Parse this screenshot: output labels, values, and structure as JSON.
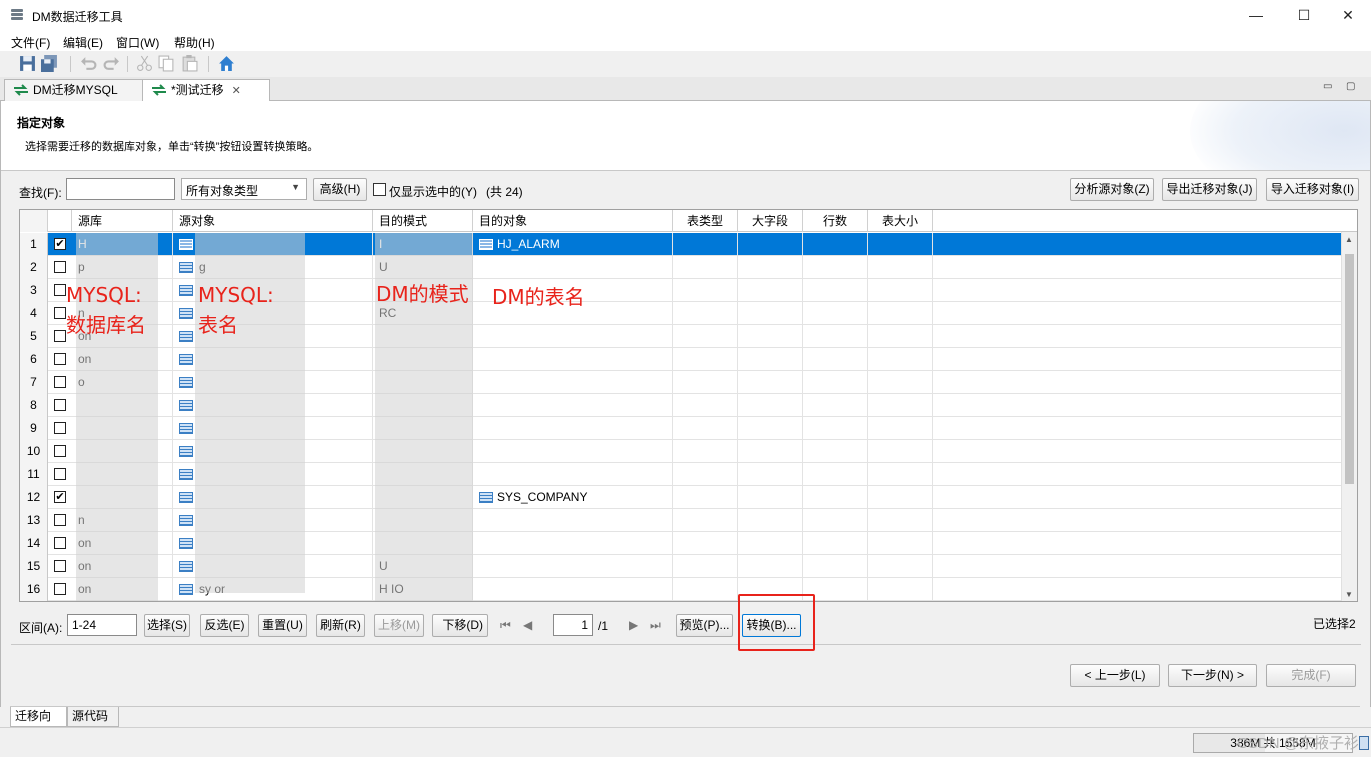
{
  "window": {
    "title": "DM数据迁移工具",
    "minimize": "—",
    "maximize": "☐",
    "close": "✕"
  },
  "menu": [
    "文件(F)",
    "编辑(E)",
    "窗口(W)",
    "帮助(H)"
  ],
  "tabs": [
    {
      "label": "DM迁移MYSQL",
      "active": false
    },
    {
      "label": "*测试迁移",
      "active": true,
      "close": "✕"
    }
  ],
  "view_controls": {
    "minimize": "▭",
    "maximize": "▢"
  },
  "banner": {
    "title": "指定对象",
    "description": "选择需要迁移的数据库对象，单击“转换”按钮设置转换策略。"
  },
  "filter": {
    "search_label": "查找(F):",
    "search_value": "",
    "type_select": "所有对象类型",
    "advanced_button": "高级(H)",
    "only_selected_label": "仅显示选中的(Y)",
    "count_text": "(共 24)",
    "analyze_button": "分析源对象(Z)",
    "export_button": "导出迁移对象(J)",
    "import_button": "导入迁移对象(I)"
  },
  "table": {
    "columns": [
      "源库",
      "源对象",
      "目的模式",
      "目的对象",
      "表类型",
      "大字段",
      "行数",
      "表大小"
    ],
    "rows": [
      {
        "num": "1",
        "checked": true,
        "src_db": "H",
        "src_obj": "",
        "dest_schema": "I",
        "dest_obj": "HJ_ALARM",
        "selected": true
      },
      {
        "num": "2",
        "checked": false,
        "src_db": "p",
        "src_obj": "g",
        "dest_schema": "U",
        "dest_obj": ""
      },
      {
        "num": "3",
        "checked": false,
        "src_db": "",
        "src_obj": "",
        "dest_schema": "",
        "dest_obj": ""
      },
      {
        "num": "4",
        "checked": false,
        "src_db": "n",
        "src_obj": "",
        "dest_schema": "RC",
        "dest_obj": ""
      },
      {
        "num": "5",
        "checked": false,
        "src_db": "on",
        "src_obj": "",
        "dest_schema": "",
        "dest_obj": ""
      },
      {
        "num": "6",
        "checked": false,
        "src_db": "on",
        "src_obj": "",
        "dest_schema": "",
        "dest_obj": ""
      },
      {
        "num": "7",
        "checked": false,
        "src_db": "o",
        "src_obj": "",
        "dest_schema": "",
        "dest_obj": ""
      },
      {
        "num": "8",
        "checked": false,
        "src_db": "",
        "src_obj": "",
        "dest_schema": "",
        "dest_obj": ""
      },
      {
        "num": "9",
        "checked": false,
        "src_db": "",
        "src_obj": "",
        "dest_schema": "",
        "dest_obj": ""
      },
      {
        "num": "10",
        "checked": false,
        "src_db": "",
        "src_obj": "",
        "dest_schema": "",
        "dest_obj": ""
      },
      {
        "num": "11",
        "checked": false,
        "src_db": "",
        "src_obj": "",
        "dest_schema": "",
        "dest_obj": ""
      },
      {
        "num": "12",
        "checked": true,
        "src_db": "",
        "src_obj": "",
        "dest_schema": "",
        "dest_obj": "SYS_COMPANY"
      },
      {
        "num": "13",
        "checked": false,
        "src_db": "n",
        "src_obj": "",
        "dest_schema": "",
        "dest_obj": ""
      },
      {
        "num": "14",
        "checked": false,
        "src_db": "on",
        "src_obj": "",
        "dest_schema": "",
        "dest_obj": ""
      },
      {
        "num": "15",
        "checked": false,
        "src_db": "on",
        "src_obj": "",
        "dest_schema": "U",
        "dest_obj": ""
      },
      {
        "num": "16",
        "checked": false,
        "src_db": "on",
        "src_obj": "sy or",
        "dest_schema": "H IO",
        "dest_obj": ""
      }
    ]
  },
  "annotations": {
    "src_db": "MYSQL:\n数据库名",
    "src_obj": "MYSQL:\n表名",
    "dest_schema": "DM的模式",
    "dest_obj": "DM的表名"
  },
  "pager": {
    "range_label": "区间(A):",
    "range_value": "1-24",
    "select_button": "选择(S)",
    "invert_button": "反选(E)",
    "reset_button": "重置(U)",
    "refresh_button": "刷新(R)",
    "up_button": "上移(M)",
    "down_button": "下移(D)",
    "page_value": "1",
    "page_total": "/1",
    "preview_button": "预览(P)...",
    "convert_button": "转换(B)...",
    "selected_count": "已选择2"
  },
  "wizard": {
    "prev_button": "< 上一步(L)",
    "next_button": "下一步(N) >",
    "finish_button": "完成(F)"
  },
  "bottom_tabs": [
    "迁移向导",
    "源代码"
  ],
  "status": {
    "heap": "386M 共 1558M",
    "watermark": "CSDN @东掖子衫"
  }
}
